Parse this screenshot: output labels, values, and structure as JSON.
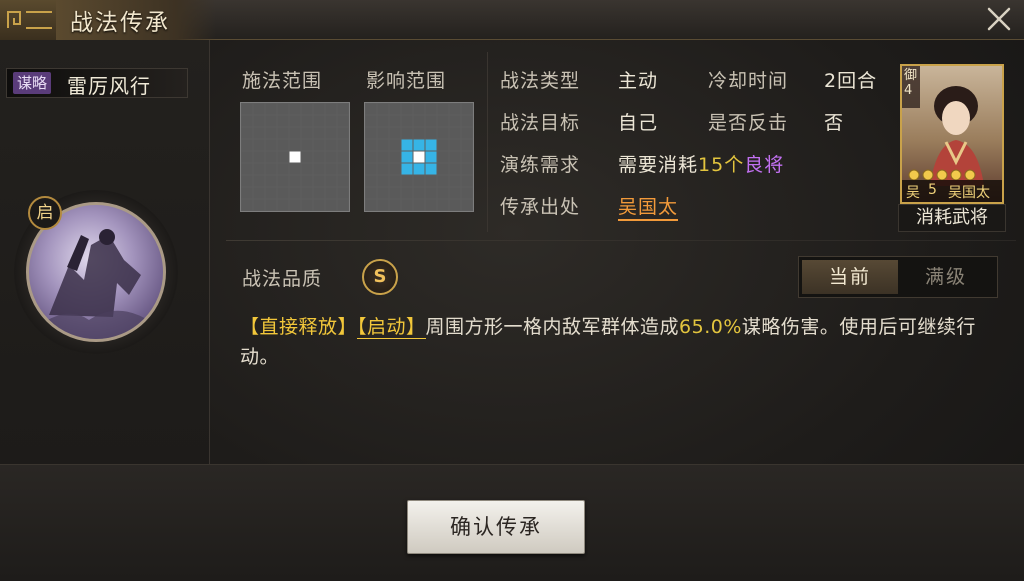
{
  "window": {
    "title": "战法传承"
  },
  "skill": {
    "type_tag": "谋略",
    "name": "雷厉风行",
    "activation_badge": "启"
  },
  "range": {
    "cast_label": "施法范围",
    "effect_label": "影响范围"
  },
  "info": {
    "skill_type_label": "战法类型",
    "skill_type_value": "主动",
    "cooldown_label": "冷却时间",
    "cooldown_value": "2回合",
    "target_label": "战法目标",
    "target_value": "自己",
    "counter_label": "是否反击",
    "counter_value": "否",
    "drill_label": "演练需求",
    "drill_prefix": "需要消耗",
    "drill_count": "15个",
    "drill_unit": "良将",
    "origin_label": "传承出处",
    "origin_value": "吴国太"
  },
  "general": {
    "troop_tag": "御",
    "troop_level": "4",
    "faction": "吴",
    "cost": "5",
    "name": "吴国太",
    "stars": 5,
    "consume_label": "消耗武将"
  },
  "quality": {
    "label": "战法品质",
    "grade": "S"
  },
  "level_toggle": {
    "current": "当前",
    "max": "满级",
    "selected": "current"
  },
  "description": {
    "tag1": "【直接释放】",
    "tag2": "【启动】",
    "text1": "周围方形一格内敌军群体造成",
    "percent": "65.0%",
    "text2": "谋略伤害。使用后可继续行动。"
  },
  "footer": {
    "confirm_label": "确认传承"
  },
  "colors": {
    "accent_gold": "#e3c53e",
    "accent_purple": "#c170f0",
    "origin_orange": "#f29a3a",
    "effect_cell": "#36b4e6"
  }
}
